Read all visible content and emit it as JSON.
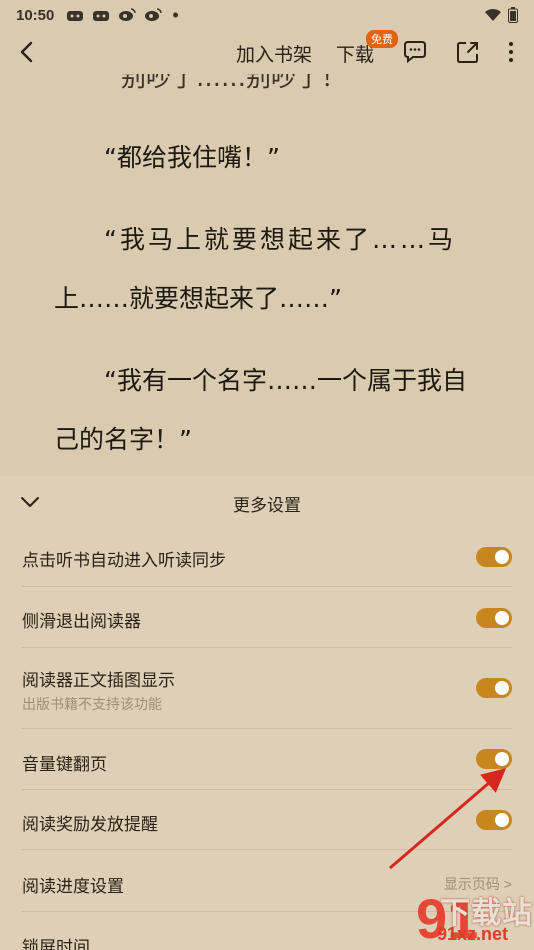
{
  "status_bar": {
    "time": "10:50",
    "dot": "•",
    "icons": [
      "game-icon",
      "game-icon",
      "weibo-icon",
      "weibo-icon",
      "wifi-icon",
      "battery-icon"
    ]
  },
  "toolbar": {
    "add_shelf": "加入书架",
    "download": "下载",
    "free_badge": "免费",
    "icons": [
      "back-icon",
      "comment-icon",
      "share-icon",
      "more-icon"
    ]
  },
  "content": {
    "lines": [
      "“别吵了……别吵了！”",
      "“都给我住嘴！”",
      "“我马上就要想起来了……马",
      "上……就要想起来了……”",
      "“我有一个名字……一个属于我自",
      "己的名字！”"
    ]
  },
  "settings": {
    "title": "更多设置",
    "items": [
      {
        "label": "点击听书自动进入听读同步",
        "toggle": true
      },
      {
        "label": "侧滑退出阅读器",
        "toggle": true
      },
      {
        "label": "阅读器正文插图显示",
        "sub": "出版书籍不支持该功能",
        "toggle": true
      },
      {
        "label": "音量键翻页",
        "toggle": true
      },
      {
        "label": "阅读奖励发放提醒",
        "toggle": true
      },
      {
        "label": "阅读进度设置",
        "value": "显示页码 >"
      },
      {
        "label": "锁屏时间"
      }
    ]
  },
  "watermark": {
    "text": "下载站",
    "url": "91xz.net",
    "number": "91"
  },
  "colors": {
    "background": "#d9cbb0",
    "sheet": "#ddd0b6",
    "toggle_on": "#c8861e",
    "badge": "#e2620f",
    "annotation_arrow": "#d8261f"
  }
}
